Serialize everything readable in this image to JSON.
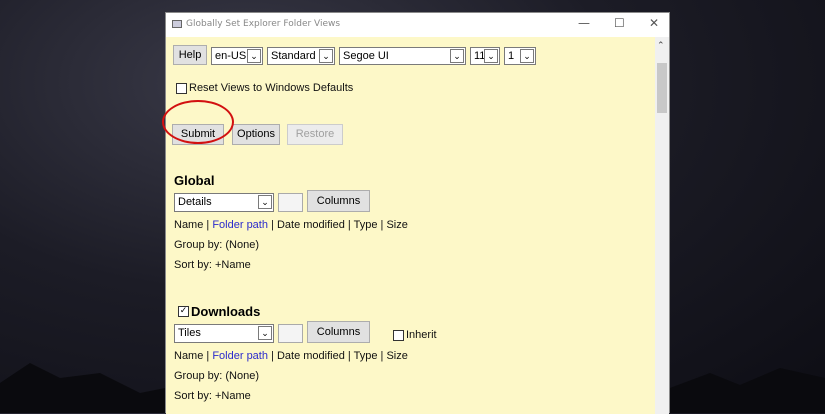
{
  "window": {
    "title": "Globally Set Explorer Folder Views"
  },
  "toolbar": {
    "help": "Help",
    "language": "en-US",
    "mode": "Standard",
    "font": "Segoe UI",
    "font_size": "11",
    "spacing": "1"
  },
  "reset": {
    "label": "Reset Views to Windows Defaults",
    "checked": false
  },
  "actions": {
    "submit": "Submit",
    "options": "Options",
    "restore": "Restore"
  },
  "sections": [
    {
      "title": "Global",
      "view": "Details",
      "columns_btn": "Columns",
      "cols": {
        "name": "Name",
        "folder_path": "Folder path",
        "date": "Date modified",
        "type": "Type",
        "size": "Size",
        "sep": " | "
      },
      "group": "Group by: (None)",
      "sort": "Sort by: +Name"
    },
    {
      "title": "Downloads",
      "checked": true,
      "view": "Tiles",
      "columns_btn": "Columns",
      "inherit": "Inherit",
      "cols": {
        "name": "Name",
        "folder_path": "Folder path",
        "date": "Date modified",
        "type": "Type",
        "size": "Size",
        "sep": " | "
      },
      "group": "Group by: (None)",
      "sort": "Sort by: +Name"
    }
  ]
}
